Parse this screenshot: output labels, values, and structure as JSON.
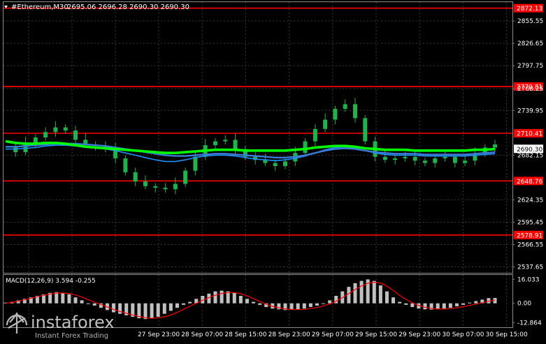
{
  "header": {
    "symbol": "#Ethereum,M30",
    "ohlc": "2695.06 2696.28 2690.30 2690.30"
  },
  "colors": {
    "background": "#000000",
    "candle": "#22b14c",
    "ma_fast": "#00ff00",
    "ma_mid": "#3a7bd5",
    "ma_slow": "#1e90ff",
    "level": "#ff0000",
    "macd_hist": "#c0c0c0",
    "macd_signal": "#ff0000",
    "grid": "#3a3a3a",
    "text": "#ffffff"
  },
  "chart_data": [
    {
      "type": "line",
      "pane": "price",
      "y_ticks": [
        "2855.55",
        "2826.65",
        "2797.75",
        "2768.25",
        "2739.95",
        "2682.15",
        "2624.35",
        "2595.45",
        "2566.55",
        "2537.65"
      ],
      "ylim": [
        2530.0,
        2880.0
      ],
      "x_labels": [
        "27 Sep 23:00",
        "28 Sep 07:00",
        "28 Sep 15:00",
        "28 Sep 23:00",
        "29 Sep 07:00",
        "29 Sep 15:00",
        "29 Sep 23:00",
        "30 Sep 07:00",
        "30 Sep 15:00"
      ],
      "levels": [
        {
          "label": "2872.13",
          "value": 2872.13
        },
        {
          "label": "2770.81",
          "value": 2770.81
        },
        {
          "label": "2710.41",
          "value": 2710.41
        },
        {
          "label": "2648.76",
          "value": 2648.76
        },
        {
          "label": "2578.91",
          "value": 2578.91
        }
      ],
      "current_price": {
        "label": "2690.30",
        "value": 2690.3
      },
      "price_series": [
        2692,
        2686,
        2698,
        2705,
        2712,
        2718,
        2714,
        2702,
        2696,
        2694,
        2690,
        2678,
        2660,
        2648,
        2642,
        2640,
        2638,
        2645,
        2662,
        2680,
        2695,
        2700,
        2702,
        2690,
        2680,
        2676,
        2672,
        2668,
        2674,
        2685,
        2700,
        2716,
        2728,
        2742,
        2748,
        2730,
        2700,
        2680,
        2676,
        2678,
        2680,
        2675,
        2672,
        2678,
        2680,
        2672,
        2675,
        2684,
        2692,
        2696
      ],
      "ma_fast": [
        2700,
        2698,
        2697,
        2697,
        2698,
        2698,
        2697,
        2695,
        2693,
        2692,
        2691,
        2690,
        2689,
        2688,
        2687,
        2686,
        2685,
        2685,
        2686,
        2687,
        2688,
        2689,
        2689,
        2689,
        2688,
        2688,
        2688,
        2688,
        2688,
        2689,
        2690,
        2692,
        2693,
        2694,
        2694,
        2693,
        2691,
        2690,
        2689,
        2689,
        2689,
        2688,
        2688,
        2688,
        2688,
        2688,
        2688,
        2689,
        2689,
        2690
      ],
      "ma_mid": [
        2693,
        2693,
        2694,
        2695,
        2696,
        2697,
        2697,
        2697,
        2696,
        2695,
        2694,
        2692,
        2690,
        2688,
        2686,
        2684,
        2682,
        2681,
        2681,
        2682,
        2683,
        2684,
        2684,
        2683,
        2682,
        2681,
        2680,
        2679,
        2679,
        2680,
        2682,
        2685,
        2688,
        2690,
        2691,
        2690,
        2688,
        2686,
        2685,
        2684,
        2684,
        2684,
        2683,
        2683,
        2683,
        2683,
        2683,
        2684,
        2685,
        2686
      ],
      "ma_slow": [
        2690,
        2690,
        2691,
        2692,
        2694,
        2695,
        2695,
        2694,
        2693,
        2692,
        2690,
        2688,
        2685,
        2682,
        2679,
        2676,
        2674,
        2674,
        2676,
        2679,
        2681,
        2682,
        2682,
        2681,
        2679,
        2677,
        2676,
        2675,
        2676,
        2678,
        2681,
        2685,
        2689,
        2692,
        2693,
        2691,
        2688,
        2685,
        2683,
        2682,
        2682,
        2682,
        2681,
        2681,
        2681,
        2681,
        2681,
        2682,
        2683,
        2684
      ]
    },
    {
      "type": "bar",
      "pane": "macd",
      "title": "MACD(12,26,9) 3.594 -0.255",
      "y_ticks": [
        "16.033",
        "0.00",
        "-12.864"
      ],
      "ylim": [
        -16.0,
        19.0
      ],
      "histogram": [
        0.5,
        1,
        2,
        3,
        4,
        5,
        6,
        7,
        7.5,
        7,
        6,
        4,
        2,
        0,
        -1.5,
        -3,
        -4.5,
        -6,
        -7,
        -8,
        -9,
        -10,
        -10.5,
        -10,
        -9,
        -7,
        -5,
        -3,
        -1,
        1,
        3,
        5,
        6.5,
        8,
        8.5,
        8,
        7,
        5,
        3,
        1,
        -1,
        -2.5,
        -3.5,
        -4,
        -4.5,
        -4.2,
        -4,
        -3.5,
        -2.5,
        -1.5,
        0,
        2,
        5,
        8,
        11,
        13.5,
        15,
        16,
        15,
        12,
        8,
        4,
        1,
        -1,
        -2.5,
        -3.5,
        -4,
        -4.2,
        -4,
        -3.5,
        -3,
        -2,
        -1,
        0.5,
        1.5,
        2.5,
        3.5,
        3.6
      ],
      "signal": [
        0,
        0.6,
        1.4,
        2.4,
        3.4,
        4.4,
        5.4,
        6.2,
        6.8,
        6.9,
        6.6,
        5.6,
        4.2,
        2.5,
        0.8,
        -0.8,
        -2.4,
        -4,
        -5.4,
        -6.6,
        -7.8,
        -8.8,
        -9.6,
        -10,
        -9.8,
        -9,
        -7.8,
        -6,
        -4,
        -2,
        0,
        2,
        3.8,
        5.4,
        6.6,
        7.2,
        7.2,
        6.4,
        5,
        3.2,
        1.2,
        -0.6,
        -2,
        -3,
        -3.7,
        -4.1,
        -4.2,
        -4,
        -3.5,
        -2.8,
        -1.8,
        -0.4,
        1.4,
        3.8,
        6.5,
        9.2,
        11.6,
        13.4,
        14.2,
        13.6,
        11.6,
        8.6,
        5.4,
        2.6,
        0.4,
        -1.4,
        -2.6,
        -3.4,
        -3.8,
        -3.8,
        -3.5,
        -3,
        -2.3,
        -1.4,
        -0.5,
        0.4,
        1.4,
        2.2
      ]
    }
  ],
  "watermark": {
    "brand": "instaforex",
    "tagline": "Instant Forex Trading"
  }
}
